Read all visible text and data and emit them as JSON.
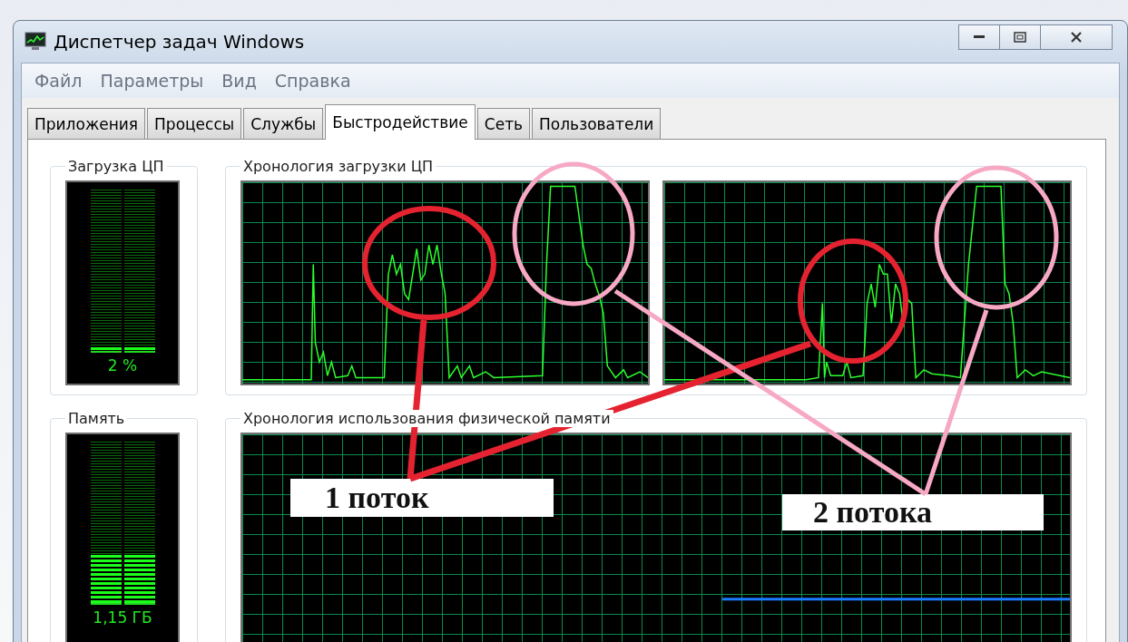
{
  "window": {
    "title": "Диспетчер задач Windows"
  },
  "menu": [
    "Файл",
    "Параметры",
    "Вид",
    "Справка"
  ],
  "tabs": [
    {
      "label": "Приложения",
      "selected": false
    },
    {
      "label": "Процессы",
      "selected": false
    },
    {
      "label": "Службы",
      "selected": false
    },
    {
      "label": "Быстродействие",
      "selected": true
    },
    {
      "label": "Сеть",
      "selected": false
    },
    {
      "label": "Пользователи",
      "selected": false
    }
  ],
  "cpu_usage": {
    "title": "Загрузка ЦП",
    "reading": "2 %",
    "level": 0.02
  },
  "cpu_history": {
    "title": "Хронология загрузки ЦП"
  },
  "memory": {
    "title": "Память",
    "reading": "1,15 ГБ",
    "level": 0.3
  },
  "memory_history": {
    "title": "Хронология использования физической памяти"
  },
  "annotations": [
    {
      "label": "1 поток",
      "color": "#e52330"
    },
    {
      "label": "2 потока",
      "color": "#f7a8c4"
    }
  ]
}
